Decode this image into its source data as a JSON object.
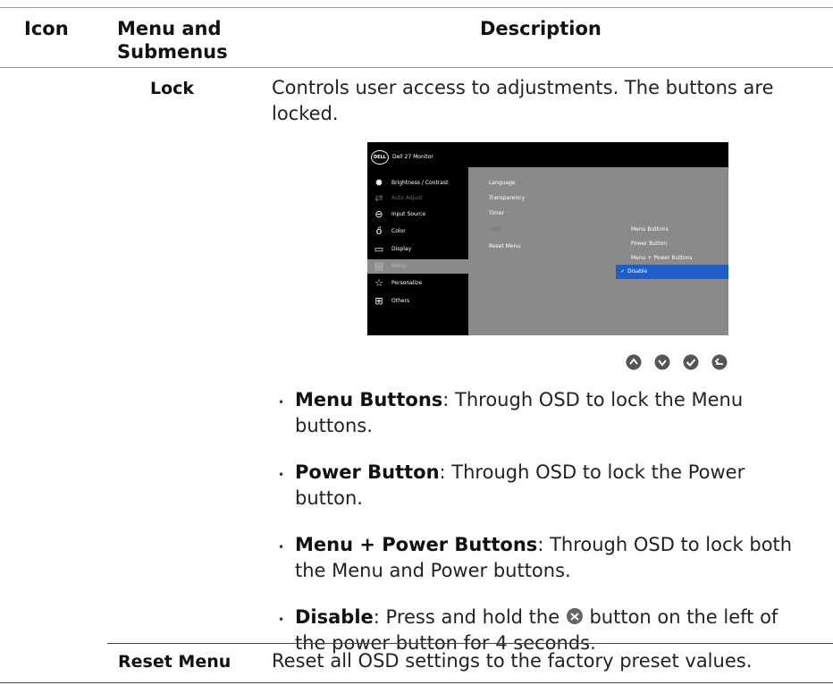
{
  "table": {
    "headers": [
      "Icon",
      "Menu and Submenus",
      "Description"
    ],
    "menu_and_submenus_line1": "Menu and",
    "menu_and_submenus_line2": "Submenus"
  },
  "lock": {
    "submenu": "Lock",
    "description_line1": "Controls user access to adjustments. The buttons are",
    "description_line2": "locked."
  },
  "osd": {
    "title": "Dell 27 Monitor",
    "logo_text": "DELL",
    "menu_items": [
      {
        "label": "Brightness / Contrast",
        "icon": "brightness-icon",
        "state": "normal"
      },
      {
        "label": "Auto Adjust",
        "icon": "auto-adjust-icon",
        "state": "dim"
      },
      {
        "label": "Input Source",
        "icon": "input-source-icon",
        "state": "normal"
      },
      {
        "label": "Color",
        "icon": "color-icon",
        "state": "normal"
      },
      {
        "label": "Display",
        "icon": "display-icon",
        "state": "normal"
      },
      {
        "label": "Menu",
        "icon": "menu-icon",
        "state": "selected"
      },
      {
        "label": "Personalize",
        "icon": "personalize-icon",
        "state": "normal"
      },
      {
        "label": "Others",
        "icon": "others-icon",
        "state": "normal"
      }
    ],
    "submenu_items": [
      "Language",
      "Transparency",
      "Timer",
      "Lock",
      "Reset Menu"
    ],
    "options": [
      "Menu Buttons",
      "Power Button",
      "Menu + Power Buttons",
      "Disable"
    ],
    "selected_option": "Disable",
    "colors": {
      "highlight": "#1f5ec9",
      "background": "#8a8a8a",
      "panel": "#000000"
    }
  },
  "nav_buttons": [
    "up-icon",
    "down-icon",
    "check-icon",
    "back-icon"
  ],
  "bullets": [
    {
      "term": "Menu Buttons",
      "text_line1": ": Through OSD to lock the Menu",
      "text_line2": "buttons."
    },
    {
      "term": "Power Button",
      "text_line1": ": Through OSD to lock the Power",
      "text_line2": "button."
    },
    {
      "term": "Menu + Power Buttons",
      "text_line1": ": Through OSD to lock both",
      "text_line2": "the Menu and Power buttons."
    },
    {
      "term": "Disable",
      "text_a": ": Press and hold the ",
      "text_b": " button on the left of",
      "text_line2": "the power button for 4 seconds."
    }
  ],
  "reset": {
    "submenu": "Reset Menu",
    "description": "Reset all OSD settings to the factory preset values."
  }
}
